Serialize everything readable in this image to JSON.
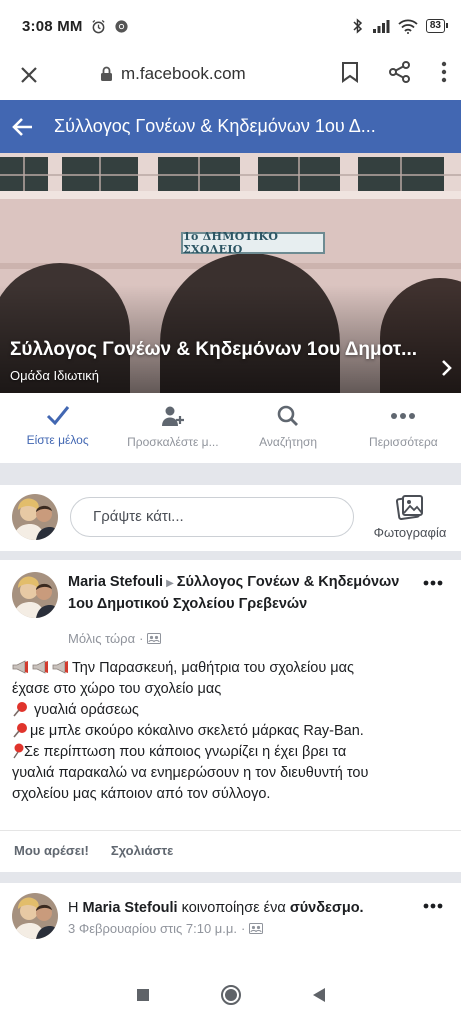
{
  "status_bar": {
    "time": "3:08 MM",
    "battery": "83"
  },
  "browser": {
    "url": "m.facebook.com"
  },
  "header": {
    "title": "Σύλλογος Γονέων & Κηδεμόνων 1ου Δ..."
  },
  "cover": {
    "sign_text": "1ο ΔΗΜΟΤΙΚΟ ΣΧΟΛΕΙΟ",
    "group_name": "Σύλλογος Γονέων & Κηδεμόνων 1ου Δημοτ...",
    "group_type": "Ομάδα Ιδιωτική"
  },
  "actions": [
    {
      "label": "Είστε μέλος",
      "icon": "check-icon"
    },
    {
      "label": "Προσκαλέστε μ...",
      "icon": "add-person-icon"
    },
    {
      "label": "Αναζήτηση",
      "icon": "search-icon"
    },
    {
      "label": "Περισσότερα",
      "icon": "more-icon"
    }
  ],
  "composer": {
    "placeholder": "Γράψτε κάτι...",
    "photo_label": "Φωτογραφία"
  },
  "post": {
    "author": "Maria Stefouli",
    "group": "Σύλλογος Γονέων & Κηδεμόνων 1ου Δημοτικού Σχολείου Γρεβενών",
    "time": "Μόλις τώρα",
    "body_lines": [
      "Την Παρασκευή, μαθήτρια του σχολείου μας",
      "έχασε στο χώρο του σχολείο μας",
      "γυαλιά οράσεως",
      "με μπλε σκούρο κόκαλινο σκελετό μάρκας Ray-Ban.",
      "Σε περίπτωση που κάποιος γνωρίζει η έχει βρει τα",
      "γυαλιά παρακαλώ να ενημερώσουν η τον διευθυντή του",
      "σχολείου μας κάποιον από τον σύλλογο."
    ],
    "like_label": "Μου αρέσει!",
    "comment_label": "Σχολιάστε"
  },
  "shared": {
    "prefix": "Η",
    "author": "Maria Stefouli",
    "middle": "κοινοποίησε ένα",
    "object": "σύνδεσμο.",
    "time": "3 Φεβρουαρίου στις 7:10 μ.μ."
  },
  "colors": {
    "fb_blue": "#4267b2",
    "divider": "#e4e6eb",
    "secondary_text": "#90949c"
  }
}
